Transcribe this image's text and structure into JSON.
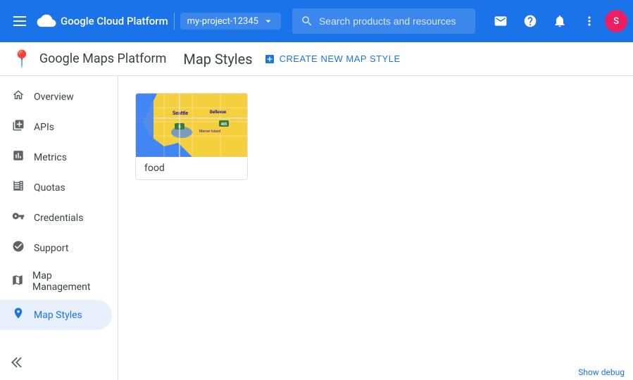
{
  "topbar": {
    "title": "Google Cloud Platform",
    "project_name": "my-project-12345",
    "search_placeholder": "Search products and resources"
  },
  "secondbar": {
    "maps_title": "Google Maps Platform",
    "page_title": "Map Styles",
    "create_label": "CREATE NEW MAP STYLE"
  },
  "sidebar": {
    "items": [
      {
        "id": "overview",
        "label": "Overview",
        "icon": "○"
      },
      {
        "id": "apis",
        "label": "APIs",
        "icon": "≡"
      },
      {
        "id": "metrics",
        "label": "Metrics",
        "icon": "▦"
      },
      {
        "id": "quotas",
        "label": "Quotas",
        "icon": "▣"
      },
      {
        "id": "credentials",
        "label": "Credentials",
        "icon": "⚷"
      },
      {
        "id": "support",
        "label": "Support",
        "icon": "👤"
      },
      {
        "id": "map-management",
        "label": "Map Management",
        "icon": "▣"
      },
      {
        "id": "map-styles",
        "label": "Map Styles",
        "icon": "◉",
        "active": true
      }
    ],
    "collapse_label": "«"
  },
  "content": {
    "map_style_name": "food"
  },
  "footer": {
    "debug_label": "Show debug"
  }
}
